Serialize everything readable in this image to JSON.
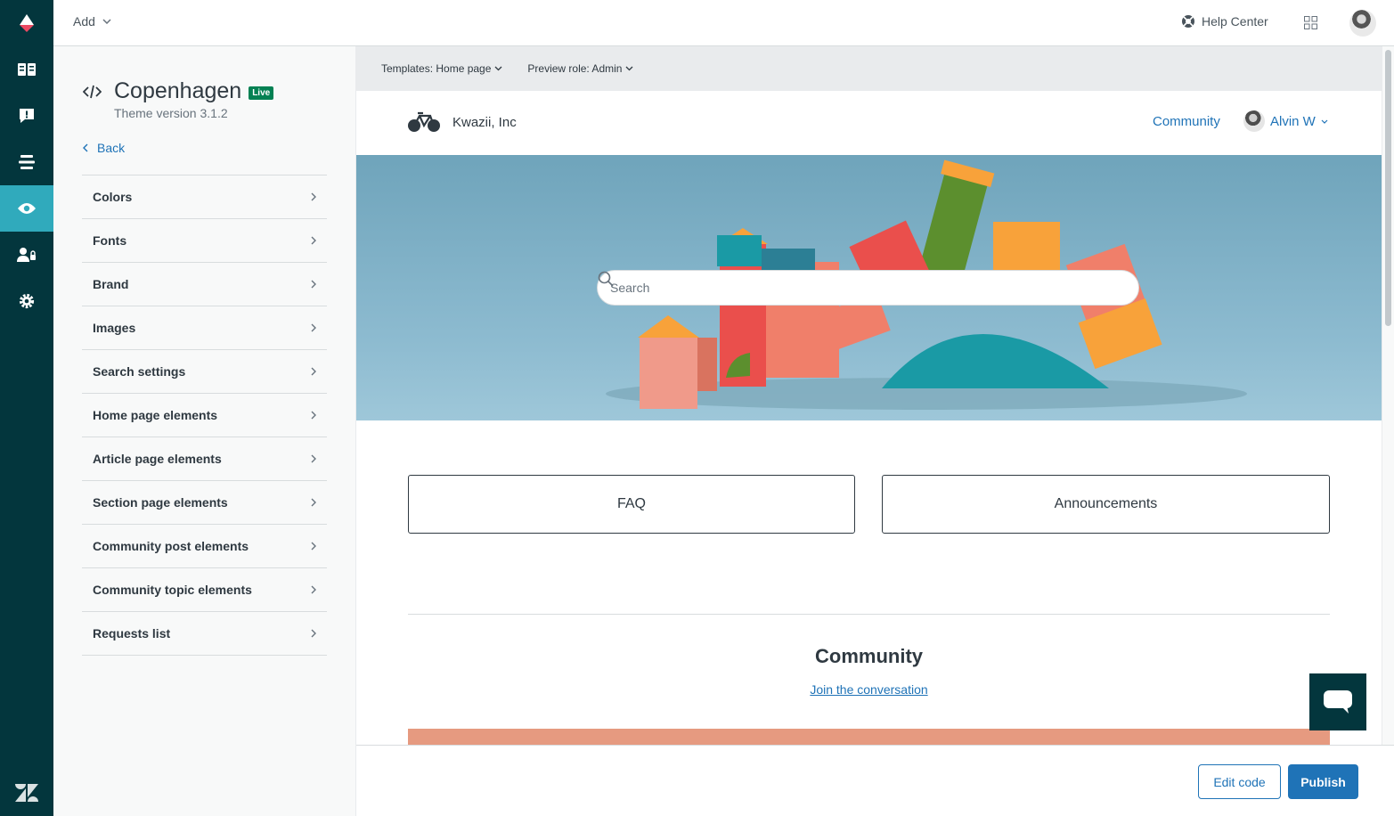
{
  "topbar": {
    "add_label": "Add",
    "help_center_label": "Help Center"
  },
  "nav_rail": {
    "items": [
      "logo-icon",
      "guide-icon",
      "feedback-icon",
      "arrange-icon",
      "eye-icon",
      "user-permissions-icon",
      "gear-icon",
      "zendesk-icon"
    ],
    "active": "eye-icon"
  },
  "theme": {
    "name": "Copenhagen",
    "badge": "Live",
    "version": "Theme version 3.1.2",
    "back_label": "Back"
  },
  "settings_menu": [
    "Colors",
    "Fonts",
    "Brand",
    "Images",
    "Search settings",
    "Home page elements",
    "Article page elements",
    "Section page elements",
    "Community post elements",
    "Community topic elements",
    "Requests list"
  ],
  "preview_toolbar": {
    "template": "Templates: Home page",
    "role": "Preview role: Admin"
  },
  "help_center": {
    "brand_name": "Kwazii, Inc",
    "nav_community": "Community",
    "user_name": "Alvin W",
    "search_placeholder": "Search",
    "blocks": [
      "FAQ",
      "Announcements"
    ],
    "community_title": "Community",
    "community_link": "Join the conversation"
  },
  "footer": {
    "edit_code": "Edit code",
    "publish": "Publish"
  },
  "colors": {
    "rail": "#03363d",
    "active": "#30aabc",
    "link": "#1f73b7",
    "live": "#038153"
  }
}
